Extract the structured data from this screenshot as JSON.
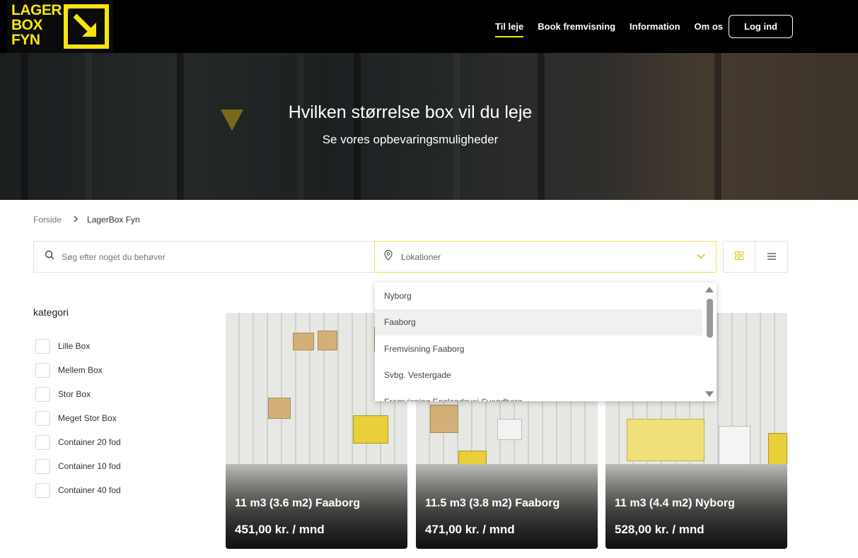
{
  "colors": {
    "accent": "#f5e50f",
    "header_bg": "#000000",
    "logo_red": "#e5232d"
  },
  "logo": {
    "line1": "LAGER",
    "line2": "BOX",
    "line3": "FYN"
  },
  "nav": {
    "items": [
      {
        "label": "Til leje",
        "active": true
      },
      {
        "label": "Book fremvisning",
        "active": false
      },
      {
        "label": "Information",
        "active": false
      },
      {
        "label": "Om os",
        "active": false
      }
    ],
    "login_label": "Log ind"
  },
  "hero": {
    "title": "Hvilken størrelse box vil du leje",
    "subtitle": "Se vores opbevaringsmuligheder"
  },
  "breadcrumb": {
    "home": "Forside",
    "current": "LagerBox Fyn"
  },
  "search": {
    "placeholder": "Søg efter noget du behøver",
    "icon": "search-icon"
  },
  "location": {
    "placeholder": "Lokationer",
    "icon": "map-pin-icon",
    "options": [
      "Nyborg",
      "Faaborg",
      "Fremvisning Faaborg",
      "Svbg. Vestergade",
      "Fremvisning Englandsvej Svendborg"
    ],
    "highlighted_index": 1
  },
  "view_toggle": {
    "grid_icon": "grid-icon",
    "list_icon": "list-icon"
  },
  "categories": {
    "title": "kategori",
    "items": [
      "Lille Box",
      "Mellem Box",
      "Stor Box",
      "Meget Stor Box",
      "Container 20 fod",
      "Container 10 fod",
      "Container 40 fod"
    ]
  },
  "cards": [
    {
      "title": "11 m3 (3.6 m2) Faaborg",
      "price": "451,00 kr. / mnd"
    },
    {
      "title": "11.5 m3 (3.8 m2) Faaborg",
      "price": "471,00 kr. / mnd"
    },
    {
      "title": "11 m3 (4.4 m2) Nyborg",
      "price": "528,00 kr. / mnd"
    }
  ]
}
